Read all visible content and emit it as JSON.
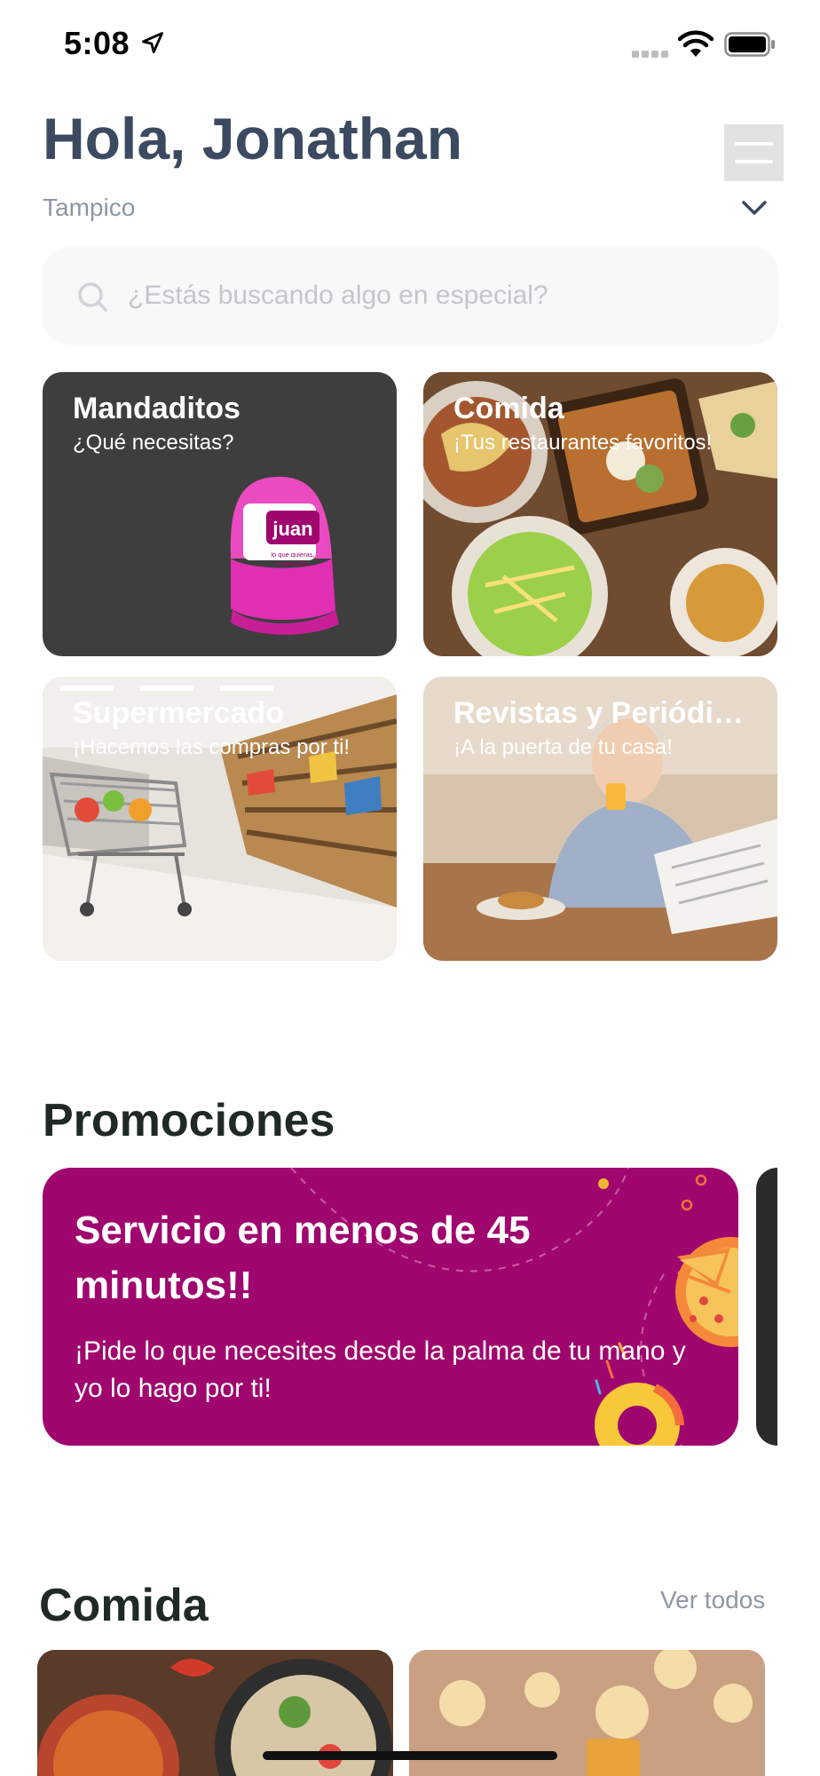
{
  "status_bar": {
    "time": "5:08"
  },
  "header": {
    "greeting": "Hola, Jonathan",
    "city": "Tampico"
  },
  "search": {
    "placeholder": "¿Estás buscando algo en especial?"
  },
  "categories": [
    {
      "title": "Mandaditos",
      "subtitle": "¿Qué necesitas?",
      "cap_text": "juan",
      "cap_tagline": "lo que quieras, a domicilio."
    },
    {
      "title": "Comida",
      "subtitle": "¡Tus restaurantes favoritos!"
    },
    {
      "title": "Supermercado",
      "subtitle": "¡Hacemos las compras por ti!"
    },
    {
      "title": "Revistas y Periódicos",
      "subtitle": "¡A la puerta de tu casa!"
    }
  ],
  "promotions": {
    "title": "Promociones",
    "banner": {
      "headline": "Servicio en menos de 45 minutos!!",
      "body": "¡Pide lo que necesites desde la palma de tu mano y yo lo hago por ti!",
      "color": "#a0076e"
    }
  },
  "food": {
    "title": "Comida",
    "see_all": "Ver todos"
  },
  "colors": {
    "brand": "#a0076e",
    "heading": "#3b4a60",
    "muted": "#8d97a5"
  }
}
